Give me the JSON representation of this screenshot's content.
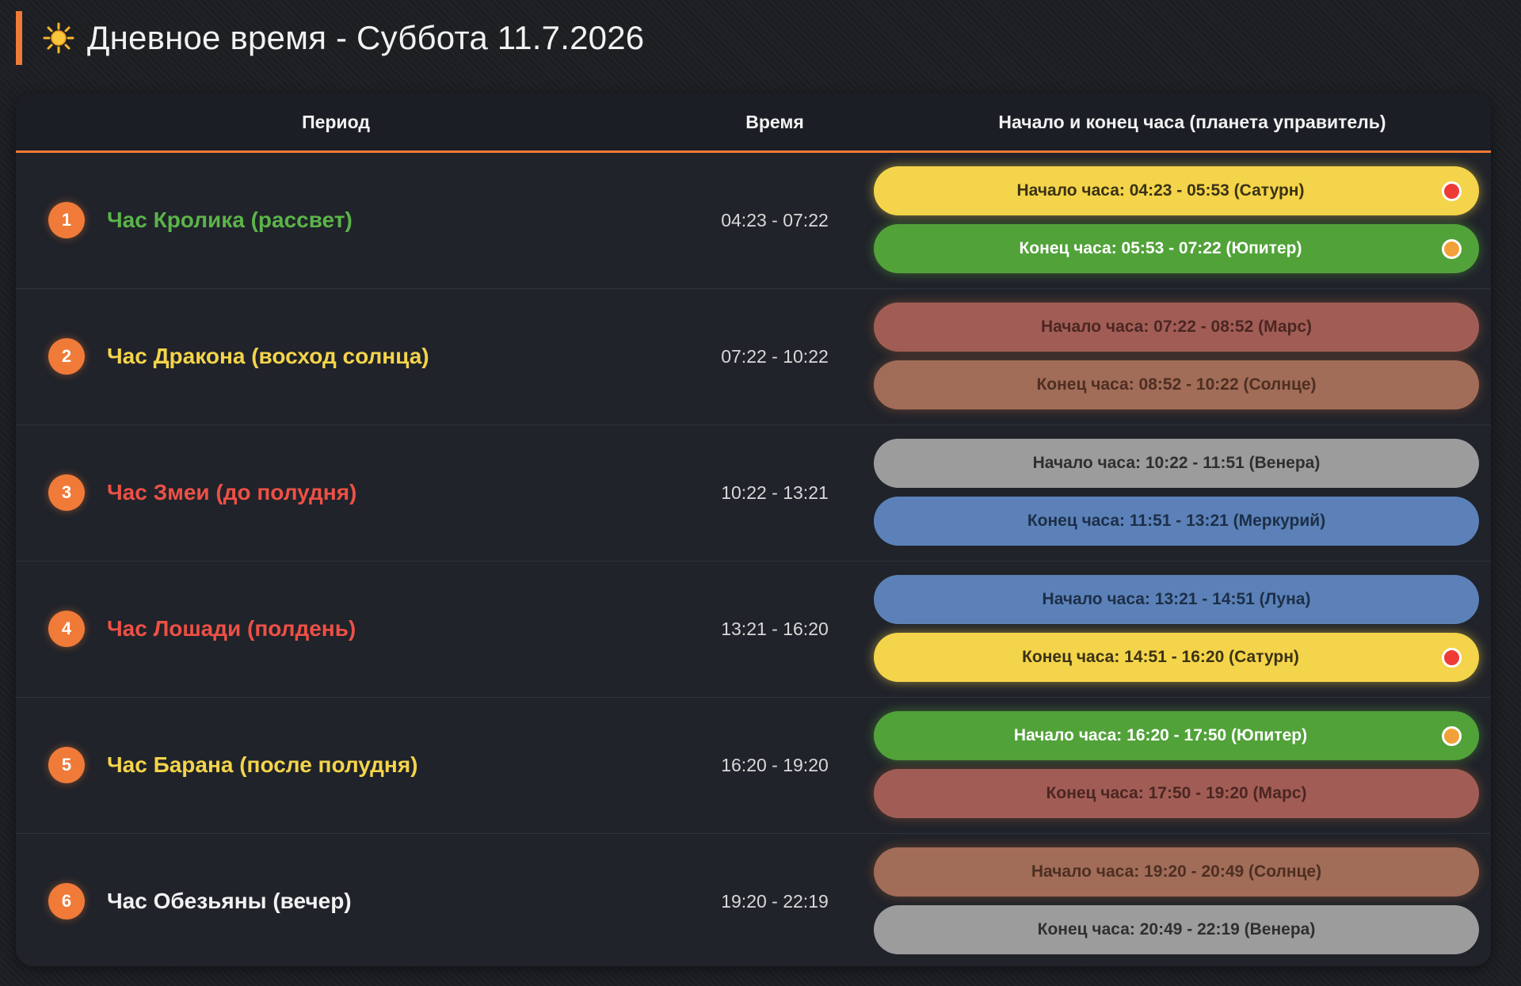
{
  "header": {
    "title": "Дневное время - Суббота 11.7.2026",
    "icon": "sun-icon",
    "accent_color": "#f07a38"
  },
  "table": {
    "headers": {
      "period": "Период",
      "time": "Время",
      "hours": "Начало и конец часа (планета управитель)"
    },
    "rows": [
      {
        "number": "1",
        "name": "Час Кролика (рассвет)",
        "name_color": "#5bb449",
        "time": "04:23 - 07:22",
        "hours": [
          {
            "label": "Начало часа: 04:23 - 05:53 (Сатурн)",
            "bg": "#f4d44a",
            "color": "#3a3214",
            "dot": "#ee3b36",
            "glow": "rgba(244,212,74,0.55)"
          },
          {
            "label": "Конец часа: 05:53 - 07:22 (Юпитер)",
            "bg": "#52a23a",
            "color": "#ffffff",
            "dot": "#f2a13a",
            "glow": "rgba(82,162,58,0.55)"
          }
        ]
      },
      {
        "number": "2",
        "name": "Час Дракона (восход солнца)",
        "name_color": "#f4d44a",
        "time": "07:22 - 10:22",
        "hours": [
          {
            "label": "Начало часа: 07:22 - 08:52 (Марс)",
            "bg": "#a15d55",
            "color": "#4b2622",
            "dot": "",
            "glow": "rgba(232,120,60,0.35)"
          },
          {
            "label": "Конец часа: 08:52 - 10:22 (Солнце)",
            "bg": "#a16c58",
            "color": "#4d2f22",
            "dot": "",
            "glow": "rgba(232,120,60,0.35)"
          }
        ]
      },
      {
        "number": "3",
        "name": "Час Змеи (до полудня)",
        "name_color": "#ee5045",
        "time": "10:22 - 13:21",
        "hours": [
          {
            "label": "Начало часа: 10:22 - 11:51 (Венера)",
            "bg": "#9c9c9c",
            "color": "#2f2f2f",
            "dot": "",
            "glow": "rgba(0,0,0,0)"
          },
          {
            "label": "Конец часа: 11:51 - 13:21 (Меркурий)",
            "bg": "#5b81b8",
            "color": "#1d2e47",
            "dot": "",
            "glow": "rgba(0,0,0,0)"
          }
        ]
      },
      {
        "number": "4",
        "name": "Час Лошади (полдень)",
        "name_color": "#ee5045",
        "time": "13:21 - 16:20",
        "hours": [
          {
            "label": "Начало часа: 13:21 - 14:51 (Луна)",
            "bg": "#5b81b8",
            "color": "#1d2e47",
            "dot": "",
            "glow": "rgba(0,0,0,0)"
          },
          {
            "label": "Конец часа: 14:51 - 16:20 (Сатурн)",
            "bg": "#f4d44a",
            "color": "#3a3214",
            "dot": "#ee3b36",
            "glow": "rgba(244,212,74,0.55)"
          }
        ]
      },
      {
        "number": "5",
        "name": "Час Барана (после полудня)",
        "name_color": "#f4d44a",
        "time": "16:20 - 19:20",
        "hours": [
          {
            "label": "Начало часа: 16:20 - 17:50 (Юпитер)",
            "bg": "#52a23a",
            "color": "#ffffff",
            "dot": "#f2a13a",
            "glow": "rgba(82,162,58,0.55)"
          },
          {
            "label": "Конец часа: 17:50 - 19:20 (Марс)",
            "bg": "#a15d55",
            "color": "#4b2622",
            "dot": "",
            "glow": "rgba(232,120,60,0.35)"
          }
        ]
      },
      {
        "number": "6",
        "name": "Час Обезьяны (вечер)",
        "name_color": "#f2f2f2",
        "time": "19:20 - 22:19",
        "hours": [
          {
            "label": "Начало часа: 19:20 - 20:49 (Солнце)",
            "bg": "#a16c58",
            "color": "#4d2f22",
            "dot": "",
            "glow": "rgba(232,120,60,0.35)"
          },
          {
            "label": "Конец часа: 20:49 - 22:19 (Венера)",
            "bg": "#9c9c9c",
            "color": "#2f2f2f",
            "dot": "",
            "glow": "rgba(0,0,0,0)"
          }
        ]
      }
    ]
  }
}
